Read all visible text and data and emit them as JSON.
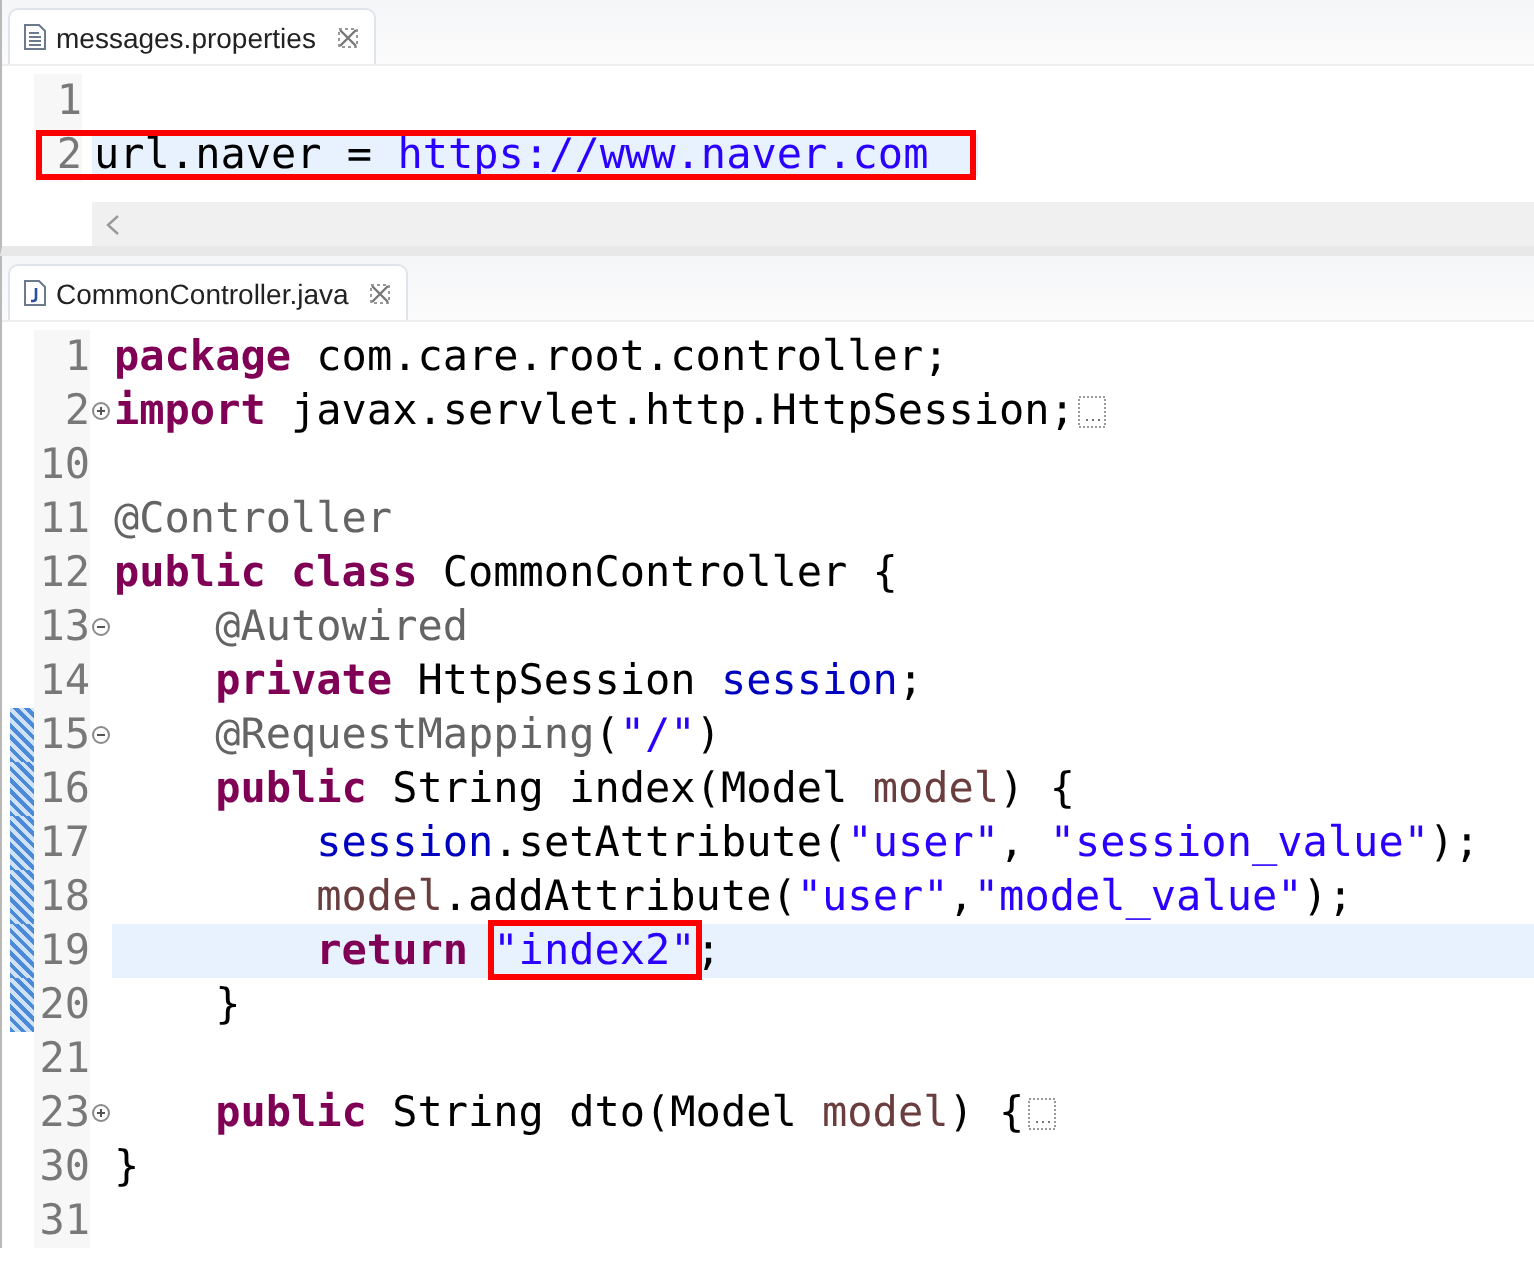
{
  "editors": [
    {
      "tab": {
        "title": "messages.properties",
        "kind": "properties"
      },
      "scrollbar": true,
      "lines": [
        {
          "number": "1"
        },
        {
          "number": "2",
          "current": true,
          "boxed": true,
          "tokens": [
            {
              "kind": "plain",
              "text": "url.naver = "
            },
            {
              "kind": "string",
              "text": "https://www.naver.com"
            }
          ]
        }
      ]
    },
    {
      "tab": {
        "title": "CommonController.java",
        "kind": "java"
      },
      "lines": [
        {
          "number": "1",
          "tokens": [
            {
              "kind": "keyword",
              "text": "package"
            },
            {
              "kind": "plain",
              "text": " com.care.root.controller;"
            }
          ]
        },
        {
          "number": "2",
          "collapsed": true,
          "tokens": [
            {
              "kind": "keyword",
              "text": "import"
            },
            {
              "kind": "plain",
              "text": " javax.servlet.http.HttpSession;"
            }
          ]
        },
        {
          "number": "10"
        },
        {
          "number": "11",
          "tokens": [
            {
              "kind": "annotation",
              "text": "@Controller"
            }
          ]
        },
        {
          "number": "12",
          "tokens": [
            {
              "kind": "keyword",
              "text": "public class"
            },
            {
              "kind": "plain",
              "text": " CommonController {"
            }
          ]
        },
        {
          "number": "13",
          "collapsed": false,
          "tokens": [
            {
              "kind": "annotation",
              "text": "    @Autowired"
            }
          ]
        },
        {
          "number": "14",
          "tokens": [
            {
              "kind": "keyword",
              "text": "    private"
            },
            {
              "kind": "plain",
              "text": " HttpSession "
            },
            {
              "kind": "field",
              "text": "session"
            },
            {
              "kind": "plain",
              "text": ";"
            }
          ]
        },
        {
          "number": "15",
          "collapsed": false,
          "changed": true,
          "tokens": [
            {
              "kind": "annotation",
              "text": "    @RequestMapping"
            },
            {
              "kind": "plain",
              "text": "("
            },
            {
              "kind": "string",
              "text": "\"/\""
            },
            {
              "kind": "plain",
              "text": ")"
            }
          ]
        },
        {
          "number": "16",
          "changed": true,
          "tokens": [
            {
              "kind": "keyword",
              "text": "    public"
            },
            {
              "kind": "plain",
              "text": " String index(Model "
            },
            {
              "kind": "local",
              "text": "model"
            },
            {
              "kind": "plain",
              "text": ") {"
            }
          ]
        },
        {
          "number": "17",
          "changed": true,
          "tokens": [
            {
              "kind": "field",
              "text": "        session"
            },
            {
              "kind": "plain",
              "text": ".setAttribute("
            },
            {
              "kind": "string",
              "text": "\"user\""
            },
            {
              "kind": "plain",
              "text": ", "
            },
            {
              "kind": "string",
              "text": "\"session_value\""
            },
            {
              "kind": "plain",
              "text": ");"
            }
          ]
        },
        {
          "number": "18",
          "changed": true,
          "tokens": [
            {
              "kind": "local",
              "text": "        model"
            },
            {
              "kind": "plain",
              "text": ".addAttribute("
            },
            {
              "kind": "string",
              "text": "\"user\""
            },
            {
              "kind": "plain",
              "text": ","
            },
            {
              "kind": "string",
              "text": "\"model_value\""
            },
            {
              "kind": "plain",
              "text": ");"
            }
          ]
        },
        {
          "number": "19",
          "changed": true,
          "current": true,
          "tokens": [
            {
              "kind": "keyword",
              "text": "        return "
            },
            {
              "kind": "string",
              "text": "\"index2\"",
              "boxed": true
            },
            {
              "kind": "plain",
              "text": ";"
            }
          ]
        },
        {
          "number": "20",
          "changed": true,
          "tokens": [
            {
              "kind": "plain",
              "text": "    }"
            }
          ]
        },
        {
          "number": "21"
        },
        {
          "number": "23",
          "collapsed": true,
          "tokens": [
            {
              "kind": "keyword",
              "text": "    public"
            },
            {
              "kind": "plain",
              "text": " String dto(Model "
            },
            {
              "kind": "local",
              "text": "model"
            },
            {
              "kind": "plain",
              "text": ") {"
            }
          ]
        },
        {
          "number": "30",
          "tokens": [
            {
              "kind": "plain",
              "text": "}"
            }
          ]
        },
        {
          "number": "31"
        }
      ]
    }
  ]
}
